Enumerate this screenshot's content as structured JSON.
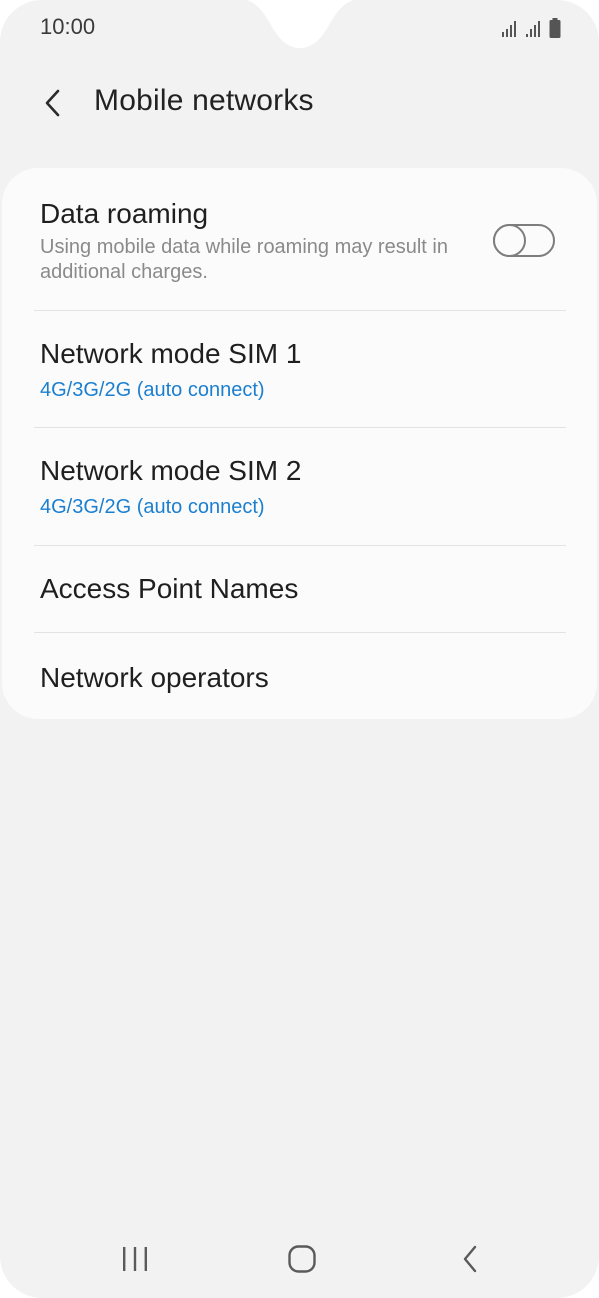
{
  "status_bar": {
    "time": "10:00"
  },
  "header": {
    "title": "Mobile networks",
    "back_icon": "chevron-left-icon"
  },
  "settings": {
    "data_roaming": {
      "title": "Data roaming",
      "subtitle": "Using mobile data while roaming may result in additional charges.",
      "enabled": false
    },
    "network_mode_sim1": {
      "title": "Network mode SIM 1",
      "value": "4G/3G/2G (auto connect)"
    },
    "network_mode_sim2": {
      "title": "Network mode SIM 2",
      "value": "4G/3G/2G (auto connect)"
    },
    "access_point_names": {
      "title": "Access Point Names"
    },
    "network_operators": {
      "title": "Network operators"
    }
  },
  "nav_bar": {
    "recents_icon": "recents-icon",
    "home_icon": "home-icon",
    "back_icon": "back-icon"
  },
  "colors": {
    "background": "#f2f2f2",
    "card": "#fbfbfb",
    "accent_blue": "#1b7fd0",
    "secondary_text": "#8a8a8a"
  }
}
